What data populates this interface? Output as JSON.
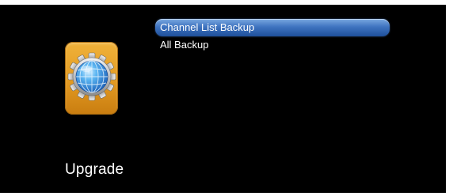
{
  "section": {
    "title": "Upgrade",
    "icon": "globe-gear-icon"
  },
  "menu": {
    "items": [
      {
        "label": "Channel List Backup",
        "selected": true
      },
      {
        "label": "All Backup",
        "selected": false
      }
    ]
  },
  "colors": {
    "background": "#000000",
    "highlight": "#3f74c0",
    "icon_tile": "#e29a22",
    "text": "#ffffff"
  }
}
